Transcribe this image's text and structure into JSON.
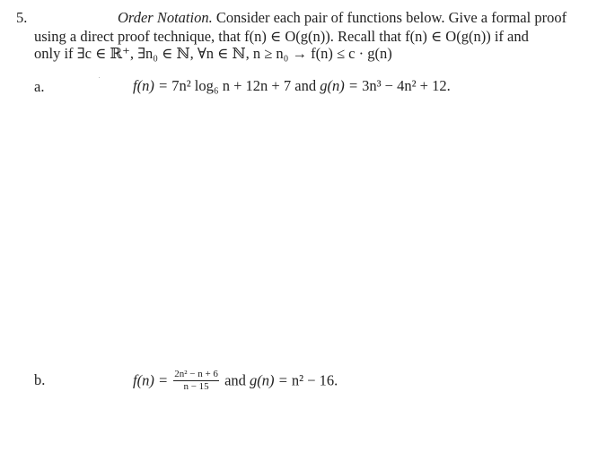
{
  "problem": {
    "number": "5.",
    "title": "Order Notation.",
    "intro_line1_rest": " Consider each pair of functions below. Give a formal proof",
    "intro_line2": "using a direct proof technique, that f(n) ∈ O(g(n)).  Recall that f(n) ∈ O(g(n)) if and",
    "intro_line3": "only if ∃c ∈ ℝ⁺, ∃n₀ ∈ ℕ, ∀n ∈ ℕ, n ≥ n₀ → f(n) ≤ c · g(n)"
  },
  "parts": [
    {
      "label": "a.",
      "f_lhs": "f(n) = ",
      "f_expr": "7n² log₆ n + 12n + 7",
      "connector": " and ",
      "g_lhs": "g(n) = ",
      "g_expr": "3n³ − 4n² + 12."
    },
    {
      "label": "b.",
      "f_lhs": "f(n) = ",
      "f_numerator": "2n² − n + 6",
      "f_denominator": "n − 15",
      "connector": " and ",
      "g_lhs": "g(n) = ",
      "g_expr": "n² − 16."
    }
  ]
}
